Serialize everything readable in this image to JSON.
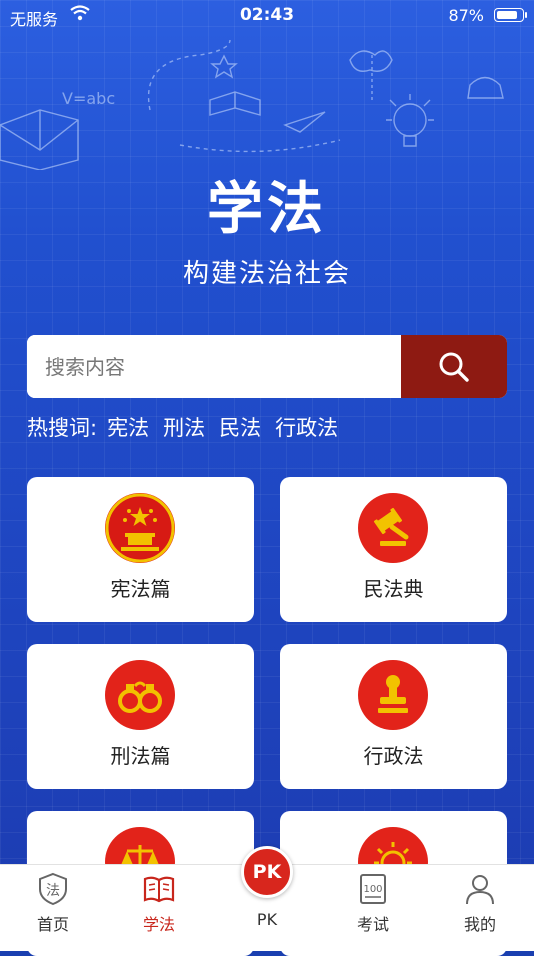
{
  "status_bar": {
    "carrier": "无服务",
    "time": "02:43",
    "battery_pct": "87%",
    "battery_level": 0.87
  },
  "hero": {
    "title": "学法",
    "subtitle": "构建法治社会"
  },
  "search": {
    "placeholder": "搜索内容"
  },
  "hot_search": {
    "label": "热搜词:",
    "terms": [
      "宪法",
      "刑法",
      "民法",
      "行政法"
    ]
  },
  "categories": [
    {
      "label": "宪法篇",
      "icon": "national-emblem-icon"
    },
    {
      "label": "民法典",
      "icon": "gavel-icon"
    },
    {
      "label": "刑法篇",
      "icon": "handcuffs-icon"
    },
    {
      "label": "行政法",
      "icon": "stamp-icon"
    },
    {
      "label": "",
      "icon": "scales-icon"
    },
    {
      "label": "",
      "icon": "lightbulb-icon"
    }
  ],
  "tabbar": {
    "items": [
      {
        "label": "首页",
        "icon": "shield-law-icon",
        "active": false
      },
      {
        "label": "学法",
        "icon": "book-icon",
        "active": true
      },
      {
        "label": "PK",
        "icon": "pk-badge-icon",
        "active": false
      },
      {
        "label": "考试",
        "icon": "exam-score-icon",
        "active": false
      },
      {
        "label": "我的",
        "icon": "user-icon",
        "active": false
      }
    ],
    "pk_badge": "PK",
    "law_glyph": "法",
    "score_glyph": "100"
  },
  "colors": {
    "brand_blue": "#1f47c3",
    "accent_red": "#e2231a",
    "search_button": "#8e1a12",
    "active_tab": "#c8261c"
  },
  "decor": {
    "formula": "V=abc"
  }
}
